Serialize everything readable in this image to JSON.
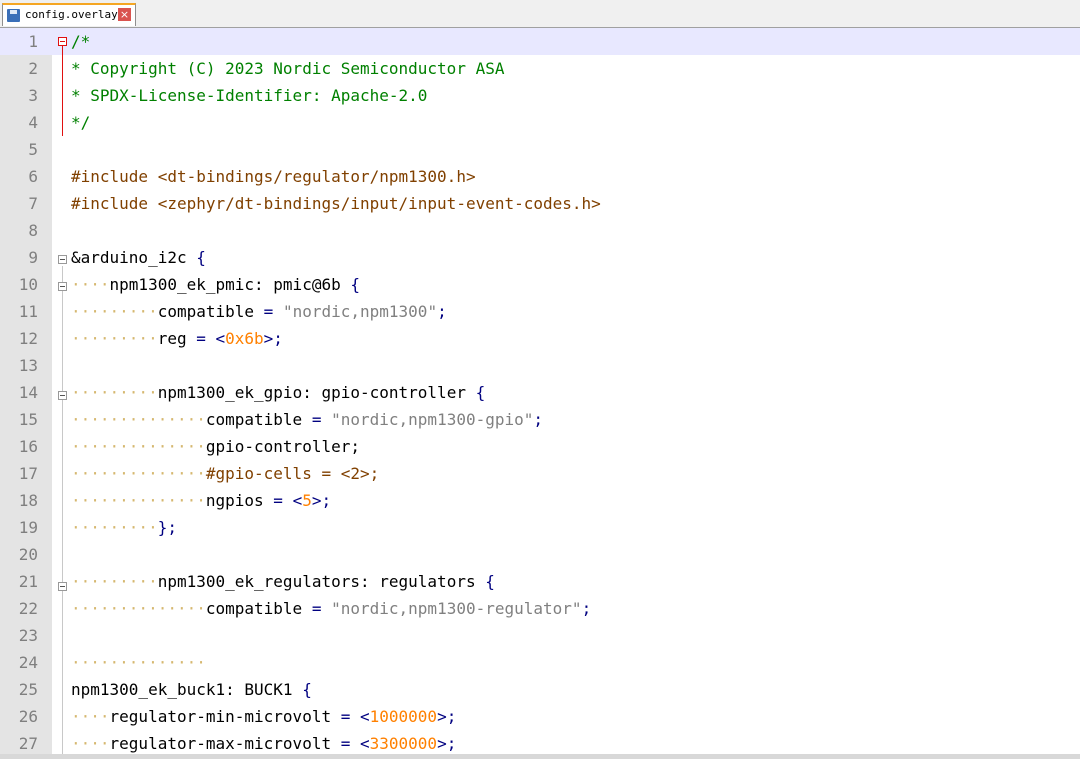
{
  "tab": {
    "filename": "config.overlay",
    "icon": "save-icon",
    "close_icon": "close-icon"
  },
  "lines": [
    {
      "n": "1",
      "tokens": [
        [
          "c-com",
          "/*"
        ]
      ]
    },
    {
      "n": "2",
      "tokens": [
        [
          "c-com",
          "* Copyright (C) 2023 Nordic Semiconductor ASA"
        ]
      ]
    },
    {
      "n": "3",
      "tokens": [
        [
          "c-com",
          "* SPDX-License-Identifier: Apache-2.0"
        ]
      ]
    },
    {
      "n": "4",
      "tokens": [
        [
          "c-com",
          "*/"
        ]
      ]
    },
    {
      "n": "5",
      "tokens": []
    },
    {
      "n": "6",
      "tokens": [
        [
          "c-pre",
          "#include <dt-bindings/regulator/npm1300.h>"
        ]
      ]
    },
    {
      "n": "7",
      "tokens": [
        [
          "c-pre",
          "#include <zephyr/dt-bindings/input/input-event-codes.h>"
        ]
      ]
    },
    {
      "n": "8",
      "tokens": []
    },
    {
      "n": "9",
      "tokens": [
        [
          "",
          "&arduino_i2c "
        ],
        [
          "c-op",
          "{"
        ]
      ]
    },
    {
      "n": "10",
      "tokens": [
        [
          "ws",
          "····"
        ],
        [
          "",
          "npm1300_ek_pmic: pmic@6b "
        ],
        [
          "c-op",
          "{"
        ]
      ]
    },
    {
      "n": "11",
      "tokens": [
        [
          "ws",
          "·········"
        ],
        [
          "",
          "compatible "
        ],
        [
          "c-op",
          "="
        ],
        [
          "c-str",
          " \"nordic,npm1300\""
        ],
        [
          "c-op",
          ";"
        ]
      ]
    },
    {
      "n": "12",
      "tokens": [
        [
          "ws",
          "·········"
        ],
        [
          "",
          "reg "
        ],
        [
          "c-op",
          "= <"
        ],
        [
          "c-num",
          "0x6b"
        ],
        [
          "c-op",
          ">;"
        ]
      ]
    },
    {
      "n": "13",
      "tokens": []
    },
    {
      "n": "14",
      "tokens": [
        [
          "ws",
          "·········"
        ],
        [
          "",
          "npm1300_ek_gpio: gpio-controller "
        ],
        [
          "c-op",
          "{"
        ]
      ]
    },
    {
      "n": "15",
      "tokens": [
        [
          "ws",
          "··············"
        ],
        [
          "",
          "compatible "
        ],
        [
          "c-op",
          "="
        ],
        [
          "c-str",
          " \"nordic,npm1300-gpio\""
        ],
        [
          "c-op",
          ";"
        ]
      ]
    },
    {
      "n": "16",
      "tokens": [
        [
          "ws",
          "··············"
        ],
        [
          "",
          "gpio-controller;"
        ]
      ]
    },
    {
      "n": "17",
      "tokens": [
        [
          "ws",
          "··············"
        ],
        [
          "c-pre",
          "#gpio-cells = <2>;"
        ]
      ]
    },
    {
      "n": "18",
      "tokens": [
        [
          "ws",
          "··············"
        ],
        [
          "",
          "ngpios "
        ],
        [
          "c-op",
          "= <"
        ],
        [
          "c-num",
          "5"
        ],
        [
          "c-op",
          ">;"
        ]
      ]
    },
    {
      "n": "19",
      "tokens": [
        [
          "ws",
          "·········"
        ],
        [
          "c-op",
          "};"
        ]
      ]
    },
    {
      "n": "20",
      "tokens": []
    },
    {
      "n": "21",
      "tokens": [
        [
          "ws",
          "·········"
        ],
        [
          "",
          "npm1300_ek_regulators: regulators "
        ],
        [
          "c-op",
          "{"
        ]
      ]
    },
    {
      "n": "22",
      "tokens": [
        [
          "ws",
          "··············"
        ],
        [
          "",
          "compatible "
        ],
        [
          "c-op",
          "="
        ],
        [
          "c-str",
          " \"nordic,npm1300-regulator\""
        ],
        [
          "c-op",
          ";"
        ]
      ]
    },
    {
      "n": "23",
      "tokens": []
    },
    {
      "n": "24",
      "tokens": [
        [
          "ws",
          "··············"
        ]
      ]
    },
    {
      "n": "25",
      "tokens": [
        [
          "",
          "npm1300_ek_buck1: BUCK1 "
        ],
        [
          "c-op",
          "{"
        ]
      ]
    },
    {
      "n": "26",
      "tokens": [
        [
          "ws",
          "····"
        ],
        [
          "",
          "regulator-min-microvolt "
        ],
        [
          "c-op",
          "= <"
        ],
        [
          "c-num",
          "1000000"
        ],
        [
          "c-op",
          ">;"
        ]
      ]
    },
    {
      "n": "27",
      "tokens": [
        [
          "ws",
          "····"
        ],
        [
          "",
          "regulator-max-microvolt "
        ],
        [
          "c-op",
          "= <"
        ],
        [
          "c-num",
          "3300000"
        ],
        [
          "c-op",
          ">;"
        ]
      ]
    }
  ]
}
